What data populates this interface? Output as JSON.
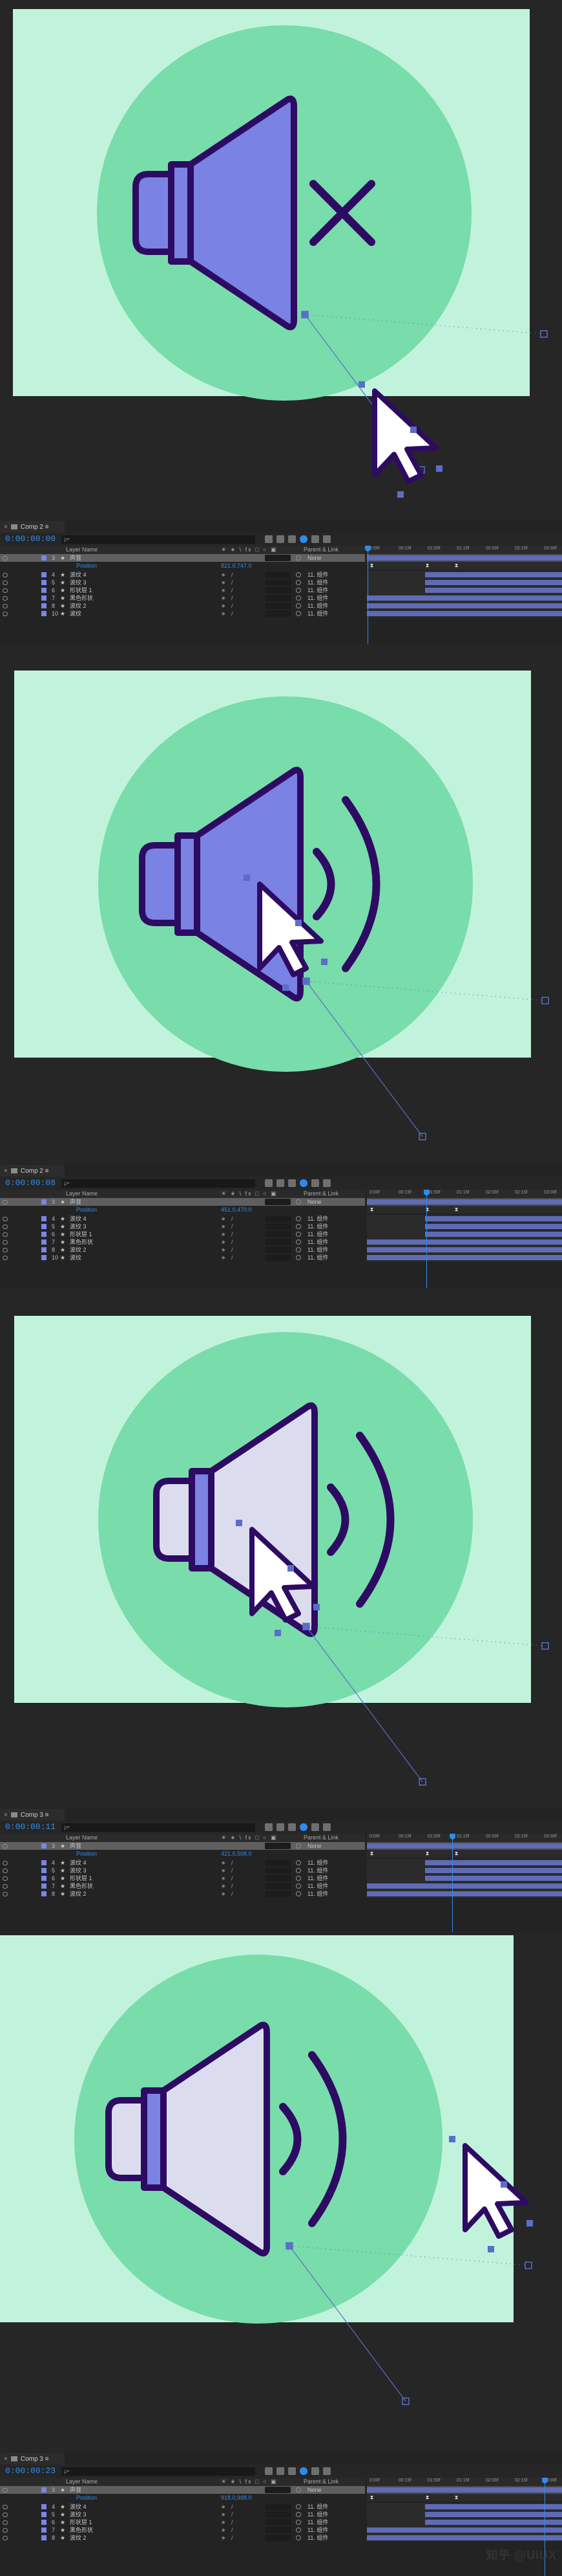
{
  "colors": {
    "canvas_bg": "#c1f3dc",
    "circle": "#79dcab",
    "speaker_active": "#7a82e3",
    "speaker_inactive": "#dcdcef",
    "outline": "#2e0b63",
    "timecode": "#2d8ceb",
    "layer_label": "#7c84e6",
    "work_area": "#4a5fbf"
  },
  "columns": {
    "name": "Layer Name",
    "parent": "Parent & Link",
    "switches": "☀ ∗ \\ fx □ ○ ▣"
  },
  "ruler_ticks": [
    "0:00f",
    "00:15f",
    "01:00f",
    "01:15f",
    "02:00f",
    "02:15f",
    "03:00f"
  ],
  "frames": [
    {
      "tab_label": "Comp 2 ≡",
      "timecode": "0:00:00:00",
      "search_placeholder": "ρ•",
      "speaker_state": "muted",
      "selected_layer_label": "声音",
      "position_label": "Position",
      "position_value": "821.0,747.0",
      "parent_label": "None",
      "layers": [
        {
          "num": "4",
          "name": "波纹 4",
          "parent": "11. 组件"
        },
        {
          "num": "5",
          "name": "波纹 3",
          "parent": "11. 组件"
        },
        {
          "num": "6",
          "name": "形状层 1",
          "parent": "11. 组件"
        },
        {
          "num": "7",
          "name": "黑色形状",
          "parent": "11. 组件"
        },
        {
          "num": "8",
          "name": "波纹 2",
          "parent": "11. 组件"
        },
        {
          "num": "10",
          "name": "波纹",
          "parent": "11. 组件"
        }
      ]
    },
    {
      "tab_label": "Comp 2 ≡",
      "timecode": "0:00:00:08",
      "search_placeholder": "ρ•",
      "speaker_state": "sound",
      "selected_layer_label": "声音",
      "position_label": "Position",
      "position_value": "451.0,470.0",
      "parent_label": "None",
      "layers": [
        {
          "num": "4",
          "name": "波纹 4",
          "parent": "11. 组件"
        },
        {
          "num": "5",
          "name": "波纹 3",
          "parent": "11. 组件"
        },
        {
          "num": "6",
          "name": "形状层 1",
          "parent": "11. 组件"
        },
        {
          "num": "7",
          "name": "黑色形状",
          "parent": "11. 组件"
        },
        {
          "num": "8",
          "name": "波纹 2",
          "parent": "11. 组件"
        },
        {
          "num": "10",
          "name": "波纹",
          "parent": "11. 组件"
        }
      ]
    },
    {
      "tab_label": "Comp 3 ≡",
      "timecode": "0:00:00:11",
      "search_placeholder": "ρ•",
      "speaker_state": "sound-light",
      "selected_layer_label": "声音",
      "position_label": "Position",
      "position_value": "421.0,508.0",
      "parent_label": "None",
      "layers": [
        {
          "num": "4",
          "name": "波纹 4",
          "parent": "11. 组件"
        },
        {
          "num": "5",
          "name": "波纹 3",
          "parent": "11. 组件"
        },
        {
          "num": "6",
          "name": "形状层 1",
          "parent": "11. 组件"
        },
        {
          "num": "7",
          "name": "黑色形状",
          "parent": "11. 组件"
        },
        {
          "num": "8",
          "name": "波纹 2",
          "parent": "11. 组件"
        }
      ]
    },
    {
      "tab_label": "Comp 3 ≡",
      "timecode": "0:00:00:23",
      "search_placeholder": "ρ•",
      "speaker_state": "sound-light",
      "selected_layer_label": "声音",
      "position_label": "Position",
      "position_value": "918.0,998.0",
      "parent_label": "None",
      "layers": [
        {
          "num": "4",
          "name": "波纹 4",
          "parent": "11. 组件"
        },
        {
          "num": "5",
          "name": "波纹 3",
          "parent": "11. 组件"
        },
        {
          "num": "6",
          "name": "形状层 1",
          "parent": "11. 组件"
        },
        {
          "num": "7",
          "name": "黑色形状",
          "parent": "11. 组件"
        },
        {
          "num": "8",
          "name": "波纹 2",
          "parent": "11. 组件"
        }
      ]
    }
  ],
  "watermark": "知乎 @UIUX"
}
